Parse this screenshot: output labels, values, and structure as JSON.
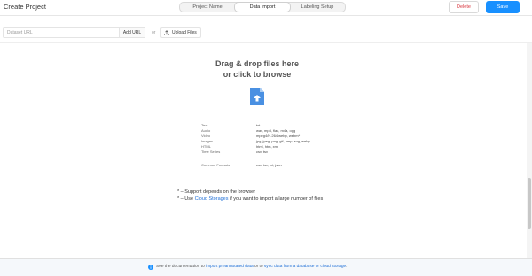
{
  "header": {
    "title": "Create Project",
    "tabs": [
      "Project Name",
      "Data Import",
      "Labeling Setup"
    ],
    "active_tab": "Data Import",
    "delete_label": "Delete",
    "save_label": "Save"
  },
  "url_bar": {
    "placeholder": "Dataset URL",
    "add_url_label": "Add URL",
    "or_label": "or",
    "upload_label": "Upload Files"
  },
  "dropzone": {
    "title_line1": "Drag & drop files here",
    "title_line2": "or click to browse",
    "icon": "file-upload-icon",
    "formats": [
      {
        "type": "Text",
        "ext": "txt"
      },
      {
        "type": "Audio",
        "ext": "wav, mp3, flac, m4a, ogg"
      },
      {
        "type": "Video",
        "ext": "mpeg4/H.264 webp, webm*"
      },
      {
        "type": "Images",
        "ext": "jpg, jpeg, png, gif, bmp, svg, webp"
      },
      {
        "type": "HTML",
        "ext": "html, htm, xml"
      },
      {
        "type": "Time Series",
        "ext": "csv, tsv"
      },
      {
        "type": "Common Formats",
        "ext": "csv, tsv, txt, json"
      }
    ],
    "note1": "* – Support depends on the browser",
    "note2_prefix": "* – Use ",
    "note2_link": "Cloud Storages",
    "note2_suffix": " if you want to import a large number of files"
  },
  "footer": {
    "icon": "info-icon",
    "t1": "See the documentation to ",
    "link1": "import preannotated data",
    "t2": " or to ",
    "link2": "sync data from a database or cloud storage",
    "t3": "."
  },
  "colors": {
    "accent": "#1890ff",
    "danger": "#d9363e",
    "link": "#1f6fd6",
    "file_icon": "#4a90e2"
  }
}
